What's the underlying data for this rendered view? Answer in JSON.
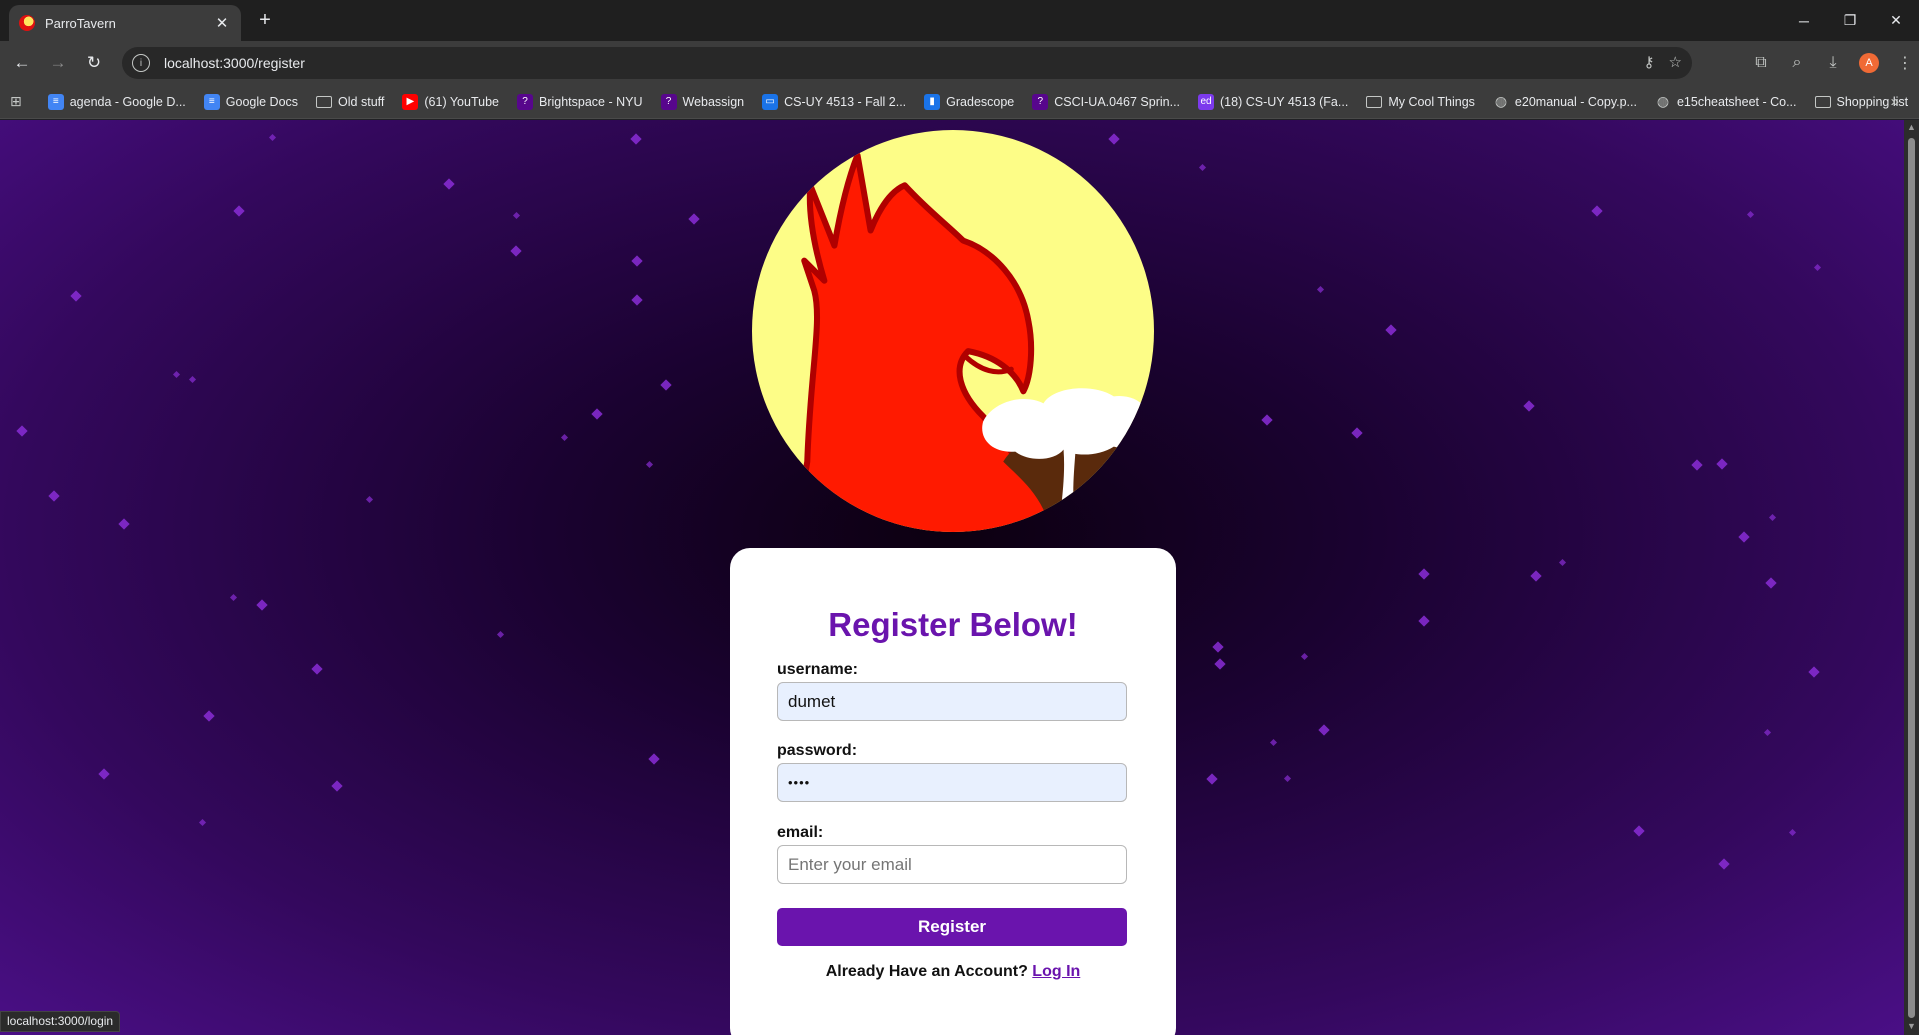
{
  "browser": {
    "tab_title": "ParroTavern",
    "url": "localhost:3000/register",
    "status_url": "localhost:3000/login",
    "profile_initial": "A",
    "bookmarks": [
      {
        "label": "agenda - Google D...",
        "icon": "docs-icon",
        "color": "#4285f4"
      },
      {
        "label": "Google Docs",
        "icon": "docs-icon",
        "color": "#4285f4"
      },
      {
        "label": "Old stuff",
        "icon": "folder-icon",
        "color": ""
      },
      {
        "label": "(61) YouTube",
        "icon": "youtube-icon",
        "color": "#ff0000"
      },
      {
        "label": "Brightspace - NYU",
        "icon": "brightspace-icon",
        "color": "#57068c"
      },
      {
        "label": "Webassign",
        "icon": "brightspace-icon",
        "color": "#57068c"
      },
      {
        "label": "CS-UY 4513 - Fall 2...",
        "icon": "cs-icon",
        "color": "#1a73e8"
      },
      {
        "label": "Gradescope",
        "icon": "gradescope-icon",
        "color": "#1a73e8"
      },
      {
        "label": "CSCI-UA.0467 Sprin...",
        "icon": "brightspace-icon",
        "color": "#57068c"
      },
      {
        "label": "(18) CS-UY 4513 (Fa...",
        "icon": "ed-icon",
        "color": "#7c3aed"
      },
      {
        "label": "My Cool Things",
        "icon": "folder-icon",
        "color": ""
      },
      {
        "label": "e20manual - Copy.p...",
        "icon": "globe-icon",
        "color": ""
      },
      {
        "label": "e15cheatsheet - Co...",
        "icon": "globe-icon",
        "color": ""
      },
      {
        "label": "Shopping list",
        "icon": "folder-icon",
        "color": ""
      }
    ]
  },
  "form": {
    "title": "Register Below!",
    "username_label": "username:",
    "username_value": "dumet",
    "password_label": "password:",
    "password_value": "••••",
    "email_label": "email:",
    "email_placeholder": "Enter your email",
    "submit_label": "Register",
    "footer_text": "Already Have an Account?",
    "login_link": "Log In"
  },
  "colors": {
    "accent": "#6a14ad",
    "moon": "#fdfd87",
    "parrot": "#ff0000"
  }
}
